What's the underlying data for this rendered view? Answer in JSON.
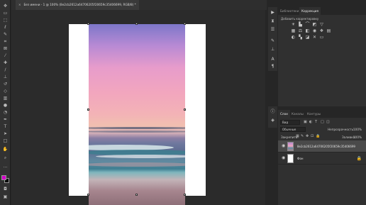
{
  "document": {
    "tab_title": "Без имени - 1 @ 100% (8e2cb2612a64706205f20659c35406699, RGB/8) *",
    "close_glyph": "×"
  },
  "toolbar": {
    "tools": [
      "move",
      "artboard",
      "marquee",
      "lasso",
      "quick-select",
      "crop",
      "frame",
      "eyedropper",
      "healing",
      "brush",
      "clone-stamp",
      "history-brush",
      "eraser",
      "gradient",
      "blur",
      "dodge",
      "pen",
      "type",
      "path-select",
      "rectangle",
      "hand",
      "zoom",
      "more"
    ],
    "foreground_color": "#d400c8",
    "background_color": "#000000"
  },
  "canvas": {
    "background": "#2b2b2b",
    "document_background": "#ffffff"
  },
  "adjustments_panel": {
    "tabs": [
      "Библиотеки",
      "Коррекция"
    ],
    "active_tab": "Коррекция",
    "hint": "Добавить корректировку"
  },
  "layers_panel": {
    "tabs": [
      "Слои",
      "Каналы",
      "Контуры"
    ],
    "active_tab": "Слои",
    "kind_filter": "Вид",
    "blend_mode": "Обычные",
    "opacity_label": "Непрозрачность:",
    "opacity_value": "100%",
    "lock_label": "Закрепить:",
    "fill_label": "Заливка:",
    "fill_value": "100%",
    "layers": [
      {
        "name": "8e2cb2612a64706205f20659c35406699",
        "selected": true,
        "thumb": "photo"
      },
      {
        "name": "Фон",
        "selected": false,
        "thumb": "white",
        "locked": true
      }
    ]
  }
}
